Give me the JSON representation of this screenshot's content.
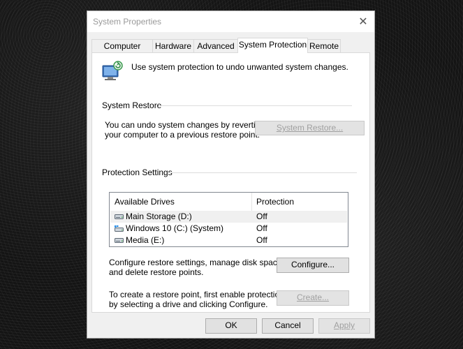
{
  "window": {
    "title": "System Properties",
    "close_glyph": "✕"
  },
  "tabs": [
    {
      "label": "Computer Name"
    },
    {
      "label": "Hardware"
    },
    {
      "label": "Advanced"
    },
    {
      "label": "System Protection",
      "active": true
    },
    {
      "label": "Remote"
    }
  ],
  "intro": {
    "text": "Use system protection to undo unwanted system changes.",
    "icon": "system-protection-icon"
  },
  "restore": {
    "heading": "System Restore",
    "description_line1": "You can undo system changes by reverting",
    "description_line2": "your computer to a previous restore point.",
    "button_label": "System Restore...",
    "button_enabled": false
  },
  "protection": {
    "heading": "Protection Settings",
    "columns": {
      "drives": "Available Drives",
      "protection": "Protection"
    },
    "drives": [
      {
        "name": "Main Storage (D:)",
        "protection": "Off",
        "icon": "hard-drive-icon",
        "selected": true
      },
      {
        "name": "Windows 10 (C:) (System)",
        "protection": "Off",
        "icon": "system-drive-icon",
        "selected": false
      },
      {
        "name": "Media (E:)",
        "protection": "Off",
        "icon": "hard-drive-icon",
        "selected": false
      }
    ],
    "configure_text_line1": "Configure restore settings, manage disk space,",
    "configure_text_line2": "and delete restore points.",
    "configure_button": "Configure...",
    "create_text_line1": "To create a restore point, first enable protection",
    "create_text_line2": "by selecting a drive and clicking Configure.",
    "create_button": "Create...",
    "create_enabled": false
  },
  "footer": {
    "ok": "OK",
    "cancel": "Cancel",
    "apply": "Apply",
    "apply_enabled": false
  }
}
